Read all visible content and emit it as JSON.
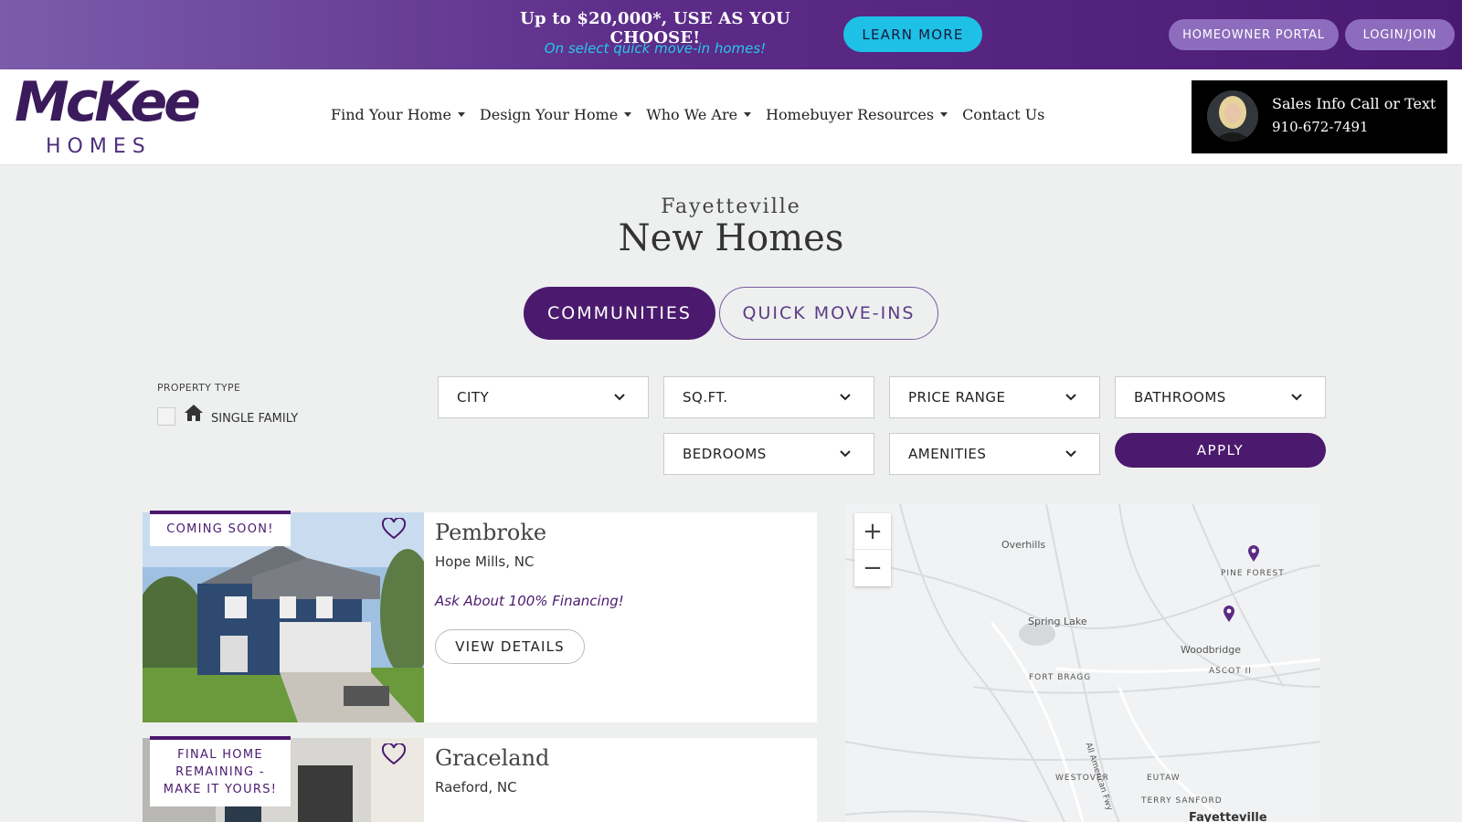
{
  "promo": {
    "title": "Up to $20,000*, USE AS YOU CHOOSE!",
    "subtitle": "On select quick move-in homes!",
    "cta_label": "LEARN MORE",
    "portal_label": "HOMEOWNER PORTAL",
    "login_label": "LOGIN/JOIN"
  },
  "brand": {
    "name": "McKee",
    "subname": "HOMES"
  },
  "nav": {
    "items": [
      {
        "label": "Find Your Home",
        "dropdown": true
      },
      {
        "label": "Design Your Home",
        "dropdown": true
      },
      {
        "label": "Who We Are",
        "dropdown": true
      },
      {
        "label": "Homebuyer Resources",
        "dropdown": true
      },
      {
        "label": "Contact Us",
        "dropdown": false
      }
    ]
  },
  "sales": {
    "title": "Sales Info Call or Text",
    "phone": "910-672-7491"
  },
  "heading": {
    "city": "Fayetteville",
    "title": "New Homes"
  },
  "tabs": {
    "communities": "COMMUNITIES",
    "quick_move_ins": "QUICK MOVE-INS"
  },
  "filters": {
    "property_type_label": "PROPERTY TYPE",
    "single_family_label": "SINGLE FAMILY",
    "city": "CITY",
    "sqft": "SQ.FT.",
    "price_range": "PRICE RANGE",
    "bathrooms": "BATHROOMS",
    "bedrooms": "BEDROOMS",
    "amenities": "AMENITIES",
    "apply_label": "APPLY"
  },
  "communities": [
    {
      "badge": "COMING SOON!",
      "name": "Pembroke",
      "location": "Hope Mills, NC",
      "promo": "Ask About 100% Financing!",
      "cta": "VIEW DETAILS"
    },
    {
      "badge": "FINAL HOME REMAINING - MAKE IT YOURS!",
      "name": "Graceland",
      "location": "Raeford, NC"
    }
  ],
  "map": {
    "zoom_in": "+",
    "zoom_out": "−",
    "labels": {
      "overhills": "Overhills",
      "pine_forest": "PINE FOREST",
      "spring_lake": "Spring Lake",
      "woodbridge": "Woodbridge",
      "ascot": "ASCOT II",
      "fort_bragg": "FORT BRAGG",
      "all_american": "All American Fwy",
      "westover": "WESTOVER",
      "eutaw": "EUTAW",
      "terry_sanford": "TERRY SANFORD",
      "fayetteville": "Fayetteville"
    }
  },
  "colors": {
    "brand_purple": "#4b1a6e",
    "accent_cyan": "#1ec0e6",
    "promo_gradient_start": "#7b5cab",
    "promo_gradient_end": "#4a1a73"
  },
  "icons": {
    "house": "house-icon",
    "heart": "heart-icon",
    "chevron": "chevron-down-icon",
    "map_pin": "map-pin-icon"
  }
}
